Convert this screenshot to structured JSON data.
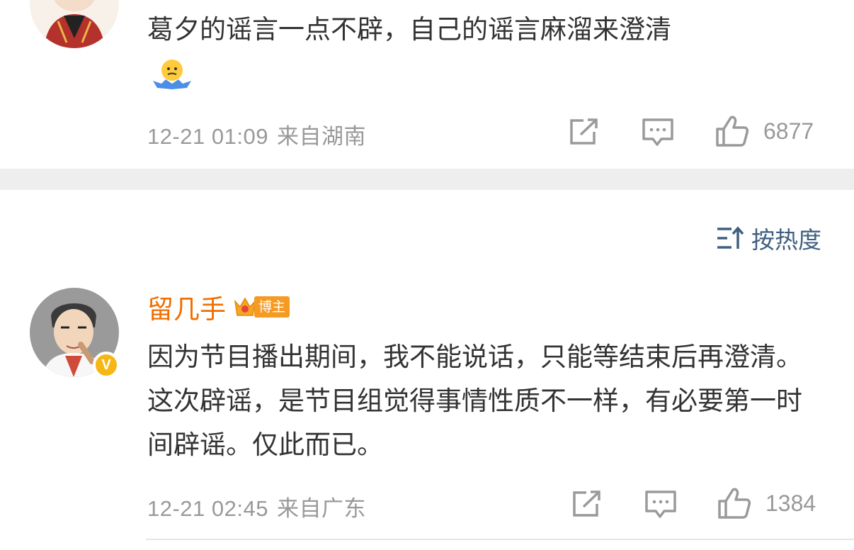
{
  "comments": [
    {
      "text": "葛夕的谣言一点不辟，自己的谣言麻溜来澄清",
      "emoji": "shrug-emoji",
      "time": "12-21 01:09",
      "location": "来自湖南",
      "likes": "6877"
    },
    {
      "username": "留几手",
      "role_badge": "博主",
      "verified_badge": "V",
      "text": "因为节目播出期间，我不能说话，只能等结束后再澄清。这次辟谣，是节目组觉得事情性质不一样，有必要第一时间辟谣。仅此而已。",
      "time": "12-21 02:45",
      "location": "来自广东",
      "likes": "1384"
    }
  ],
  "sort": {
    "label": "按热度",
    "icon": "sort-icon"
  },
  "icons": {
    "share": "share-icon",
    "reply": "comment-icon",
    "like": "thumbs-up-icon"
  },
  "colors": {
    "username": "#f16e00",
    "sort": "#3f5f80",
    "meta": "#999999",
    "separator": "#eeeeee",
    "verified": "#f6b613",
    "role_badge": "#f59a23"
  }
}
